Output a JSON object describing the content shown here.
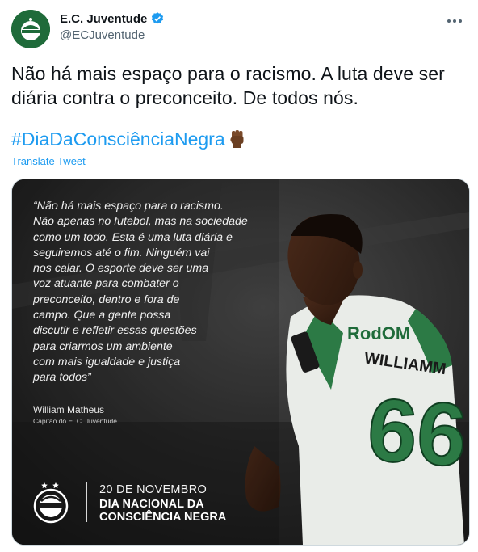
{
  "author": {
    "name": "E.C. Juventude",
    "handle": "@ECJuventude",
    "verified_icon": "verified-badge-icon"
  },
  "tweet": {
    "text": "Não há mais espaço para o racismo. A luta deve ser diária contra o preconceito. De todos nós.",
    "hashtag": "#DiaDaConsciênciaNegra",
    "translate_label": "Translate Tweet"
  },
  "media": {
    "quote": "“Não há mais espaço para o racismo.\nNão apenas no futebol, mas na sociedade\ncomo um todo. Esta é uma luta diária e\nseguiremos  até o fim. Ninguém vai\nnos calar. O esporte deve ser uma\nvoz atuante para combater o\npreconceito, dentro e fora de\ncampo. Que a gente possa\ndiscutir e refletir essas questões\npara criarmos um ambiente\ncom mais igualdade e justiça\npara todos”",
    "speaker_name": "William Matheus",
    "speaker_role": "Capitão do E. C. Juventude",
    "date_text": "20 DE NOVEMBRO",
    "event_text": "DIA NACIONAL DA\nCONSCIÊNCIA NEGRA",
    "jersey_sponsor": "RodOM",
    "jersey_name": "WILLIAMM",
    "jersey_number": "66"
  },
  "colors": {
    "link": "#1d9bf0",
    "text": "#0f1419",
    "secondary": "#536471",
    "club_green": "#1f6b3a"
  }
}
